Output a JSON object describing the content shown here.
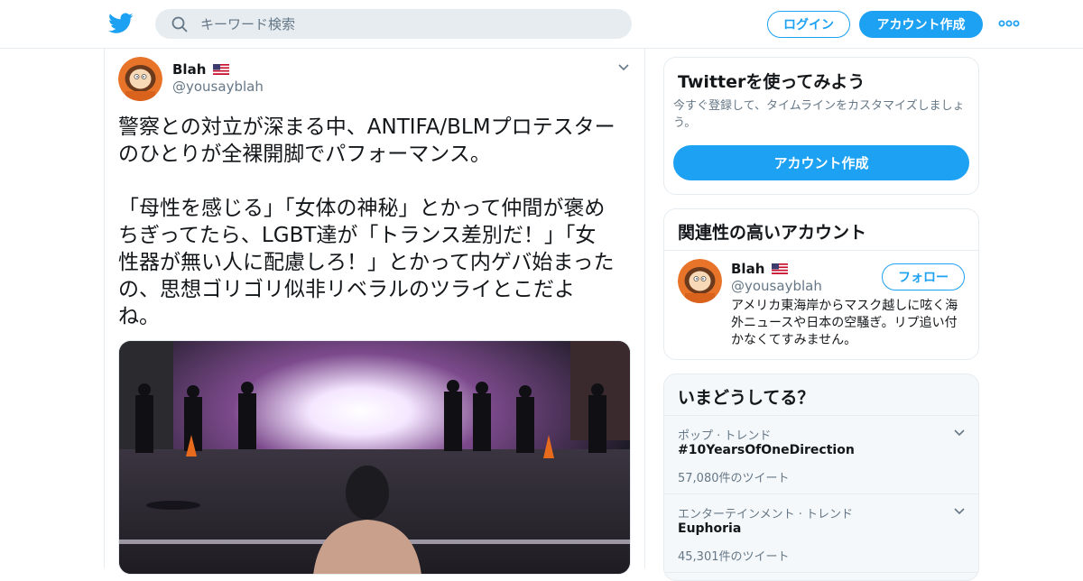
{
  "header": {
    "search_placeholder": "キーワード検索",
    "login_label": "ログイン",
    "signup_label": "アカウント作成"
  },
  "tweet": {
    "author_name": "Blah",
    "author_handle": "@yousayblah",
    "text": "警察との対立が深まる中、ANTIFA/BLMプロテスター\nのひとりが全裸開脚でパフォーマンス。\n\n「母性を感じる」「女体の神秘」とかって仲間が褒め\nちぎってたら、LGBT達が「トランス差別だ！」「女\n性器が無い人に配慮しろ！」とかって内ゲバ始まった\nの、思想ゴリゴリ似非リベラルのツライとこだよ\nね。"
  },
  "signup_card": {
    "title": "Twitterを使ってみよう",
    "description": "今すぐ登録して、タイムラインをカスタマイズしましょう。",
    "button_label": "アカウント作成"
  },
  "related_accounts": {
    "title": "関連性の高いアカウント",
    "account": {
      "name": "Blah",
      "handle": "@yousayblah",
      "follow_label": "フォロー",
      "bio": "アメリカ東海岸からマスク越しに呟く海外ニュースや日本の空騒ぎ。リプ追い付かなくてすみません。"
    }
  },
  "trends": {
    "title": "いまどうしてる？",
    "items": [
      {
        "category": "ポップ · トレンド",
        "name": "#10YearsOfOneDirection",
        "count": "57,080件のツイート"
      },
      {
        "category": "エンターテインメント · トレンド",
        "name": "Euphoria",
        "count": "45,301件のツイート"
      }
    ]
  },
  "colors": {
    "accent": "#1da1f2",
    "border": "#e6ecf0",
    "secondary_text": "#657786"
  },
  "icons": [
    "twitter-bird-icon",
    "search-icon",
    "more-dots-icon",
    "chevron-down-icon",
    "us-flag-icon"
  ]
}
